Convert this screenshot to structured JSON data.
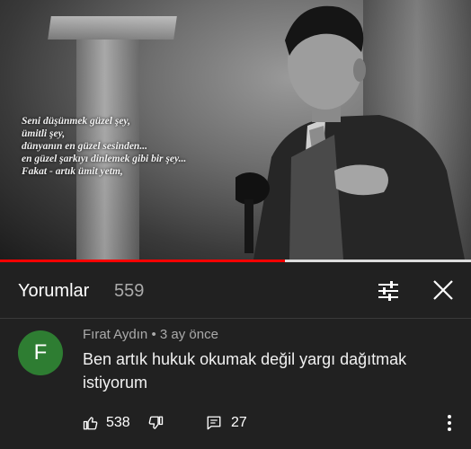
{
  "video": {
    "quote_text": "Seni düşünmek güzel şey,\nümitli şey,\ndünyanın en güzel sesinden...\nen güzel şarkıyı dinlemek gibi bir şey...\nFakat - artık ümit yetm,",
    "progress_fraction": 0.605,
    "progress_color": "#ff0000"
  },
  "comments_header": {
    "title": "Yorumlar",
    "count": "559",
    "icons": [
      "tune-icon",
      "close-icon"
    ]
  },
  "comment": {
    "avatar_letter": "F",
    "avatar_color": "#2e7d32",
    "author": "Fırat Aydın",
    "separator": "•",
    "time": "3 ay önce",
    "text": "Ben artık hukuk okumak değil yargı dağıtmak istiyorum",
    "likes": "538",
    "replies": "27",
    "icons": [
      "thumbs-up-icon",
      "thumbs-down-icon",
      "reply-icon",
      "more-vert-icon"
    ]
  }
}
